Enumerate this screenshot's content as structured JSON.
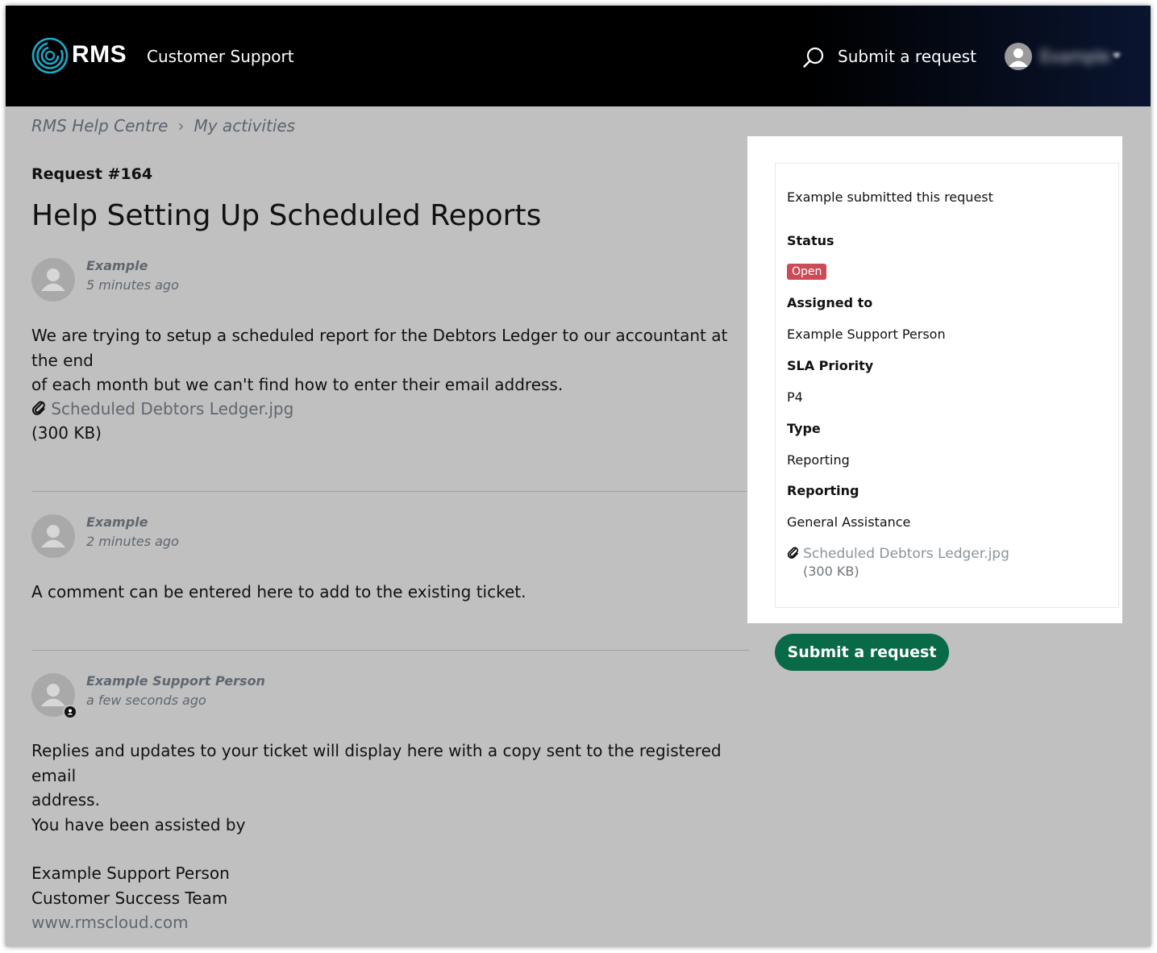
{
  "header": {
    "brand": "RMS",
    "portal_name": "Customer Support",
    "submit_link": "Submit a request",
    "user_name": "Example",
    "search_icon": "search-icon",
    "logo_icon": "rms-logo-rings"
  },
  "breadcrumb": {
    "items": [
      "RMS Help Centre",
      "My activities"
    ],
    "separator": "›"
  },
  "request": {
    "number": "Request #164",
    "title": "Help Setting Up Scheduled Reports"
  },
  "comments": [
    {
      "author": "Example",
      "time": "5 minutes ago",
      "body_lines": [
        "We are trying to setup a scheduled report for the Debtors Ledger to our accountant at the end",
        "of each month but we can't find how to enter their email address."
      ],
      "attachment": {
        "name": "Scheduled Debtors Ledger.jpg",
        "size": "(300 KB)"
      }
    },
    {
      "author": "Example",
      "time": "2 minutes ago",
      "body_lines": [
        "A comment can be entered here to add to the existing ticket."
      ]
    },
    {
      "author": "Example Support Person",
      "time": "a few seconds ago",
      "body_lines": [
        "Replies and updates to your ticket will display here with a copy sent to the registered email",
        "address.",
        "You have been assisted by",
        "",
        "Example Support Person",
        "Customer Success Team",
        "www.rmscloud.com"
      ]
    }
  ],
  "sidebar": {
    "submitted_by": "Example submitted this request",
    "status_label": "Status",
    "status_value": "Open",
    "status_color": "#cc4b55",
    "assigned_label": "Assigned to",
    "assigned_value": "Example Support Person",
    "sla_label": "SLA Priority",
    "sla_value": "P4",
    "type_label": "Type",
    "type_value": "Reporting",
    "reporting_label": "Reporting",
    "reporting_value": "General Assistance",
    "attachment_name": "Scheduled Debtors Ledger.jpg",
    "attachment_size": "(300 KB)"
  },
  "submit_button": "Submit a request",
  "colors": {
    "accent_green": "#096a48",
    "header_bg": "#000000"
  }
}
